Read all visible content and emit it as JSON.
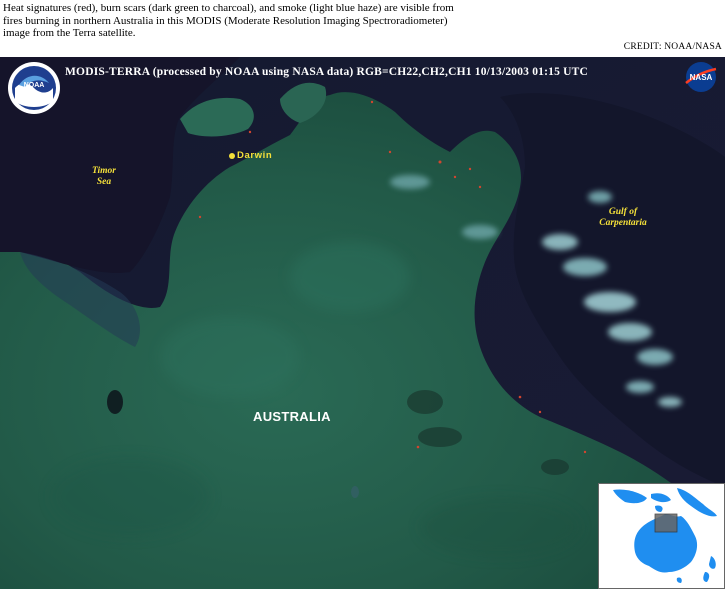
{
  "caption": {
    "lines": [
      "Heat signatures (red), burn scars (dark green to charcoal), and smoke (light blue haze) are visible from",
      "fires burning in northern Australia in this MODIS (Moderate Resolution Imaging Spectroradiometer)",
      "image from the Terra satellite."
    ]
  },
  "credit": "CREDIT: NOAA/NASA",
  "image": {
    "header": "MODIS-TERRA  (processed by NOAA using NASA data)  RGB=CH22,CH2,CH1  10/13/2003  01:15 UTC",
    "labels": {
      "timor_sea_line1": "Timor",
      "timor_sea_line2": "Sea",
      "gulf_line1": "Gulf of",
      "gulf_line2": "Carpentaria",
      "darwin": "Darwin",
      "australia": "AUSTRALIA"
    },
    "logos": {
      "left": "noaa-logo",
      "right": "nasa-logo"
    },
    "colors": {
      "label_yellow": "#f4e03a",
      "land_green": "#1f5a47",
      "ocean_dark": "#16142a",
      "smoke_light_blue": "#9fd0d4",
      "fire_red": "#d2452f"
    }
  },
  "inset_map": {
    "description_icon": "australia-locator-map-icon"
  }
}
